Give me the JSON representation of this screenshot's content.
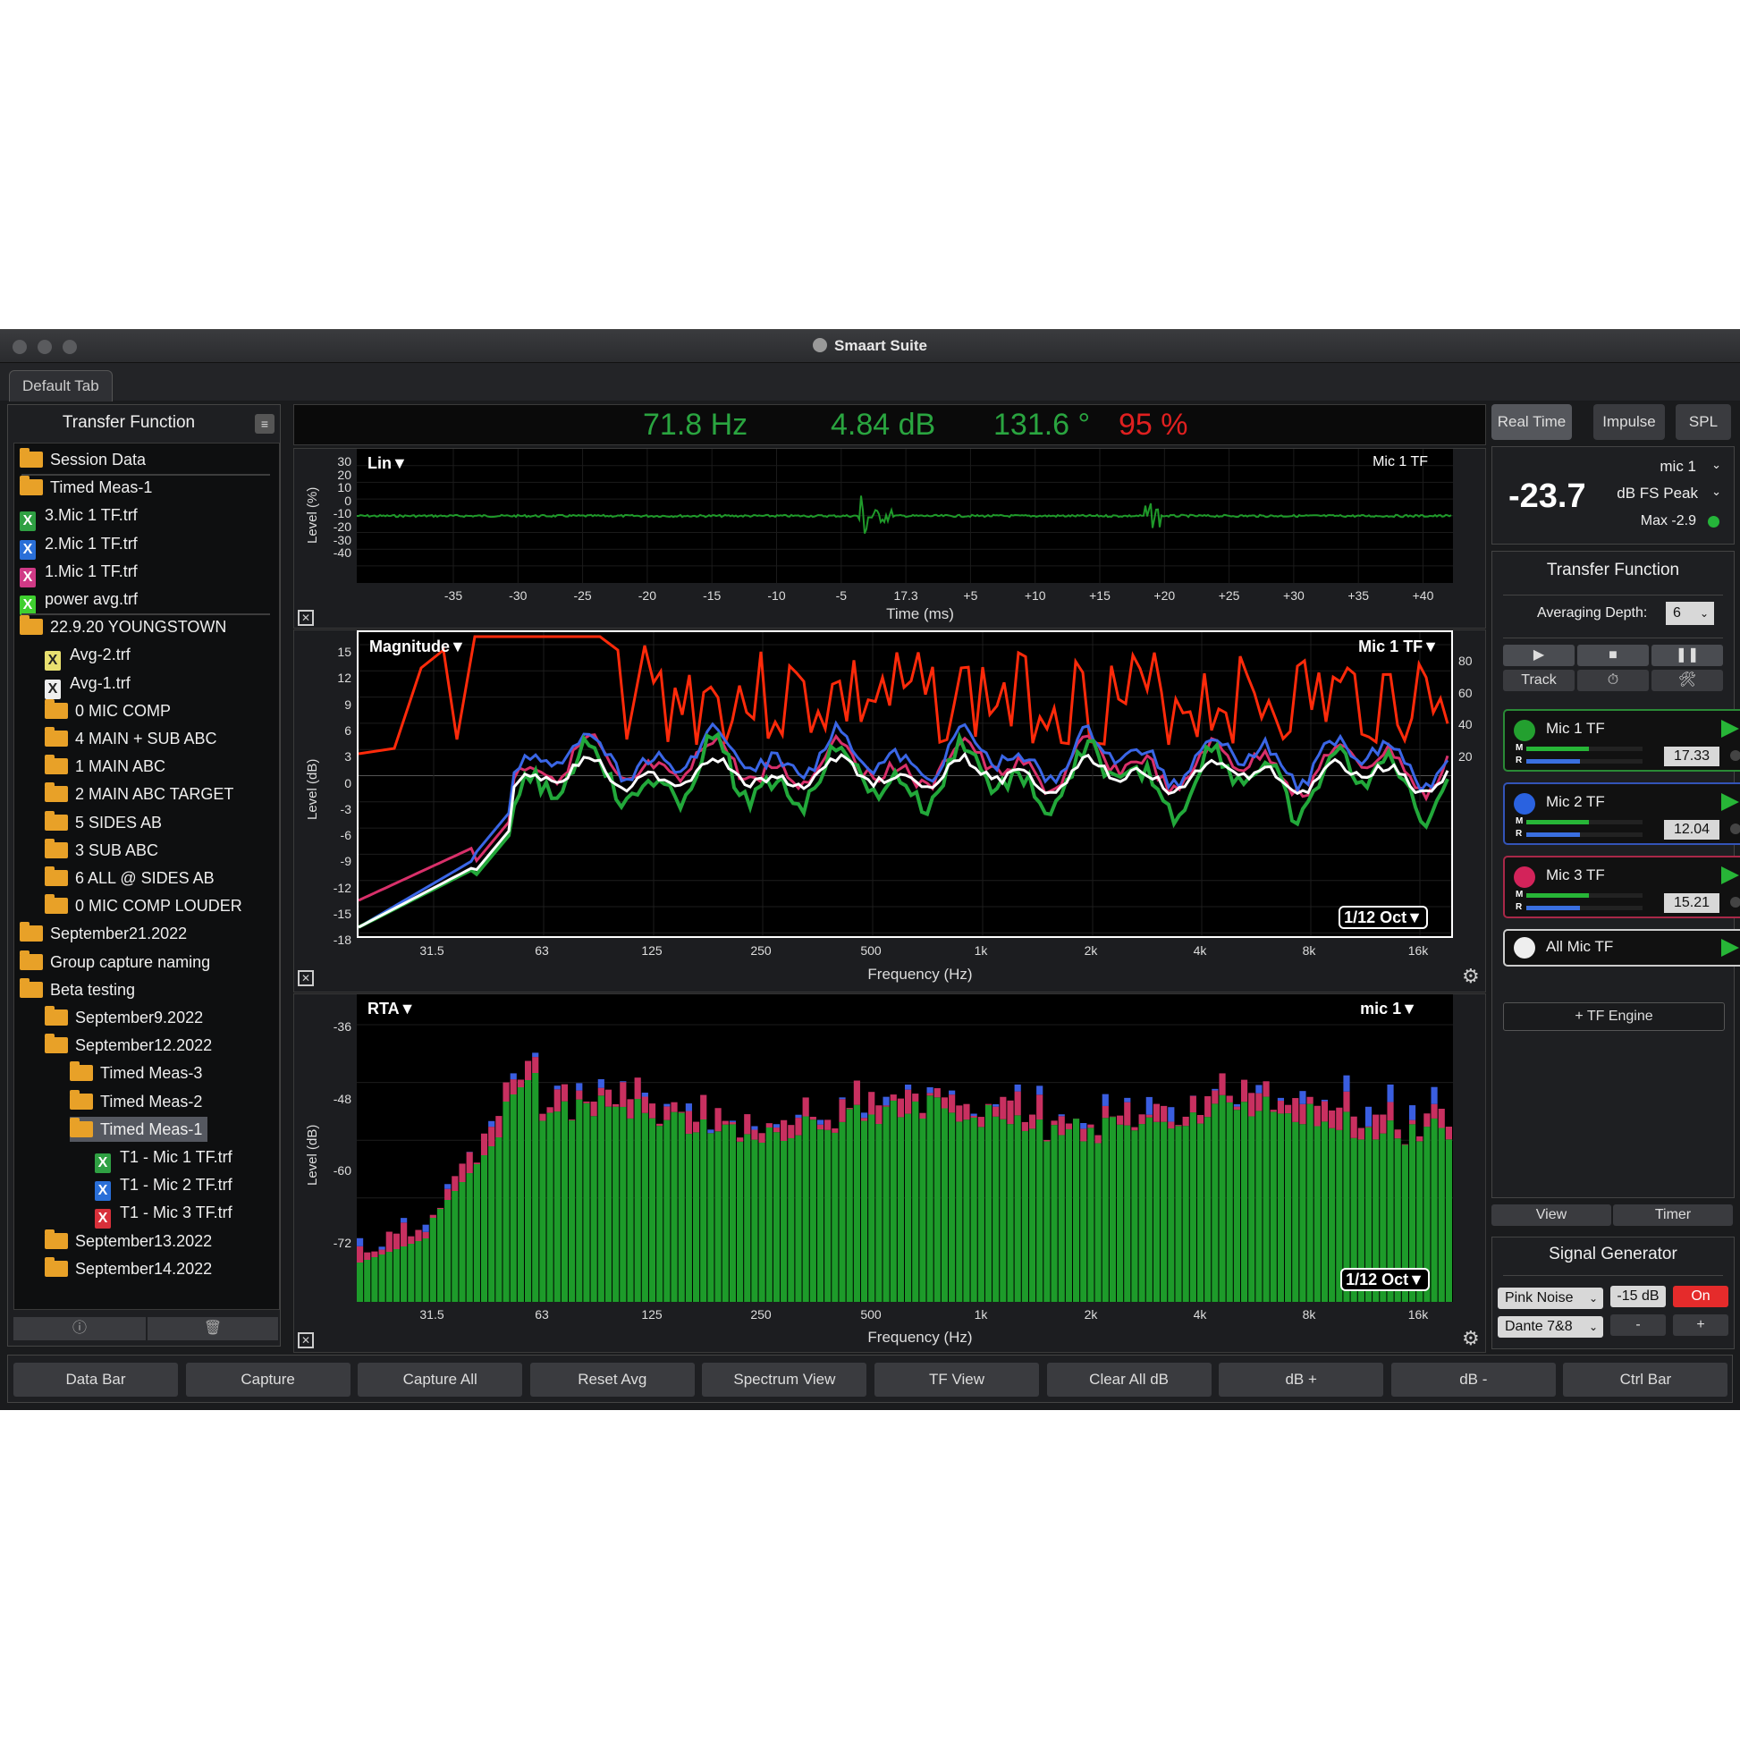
{
  "window": {
    "title": "Smaart Suite"
  },
  "tabs": [
    "Default Tab"
  ],
  "left": {
    "title": "Transfer Function",
    "tree": [
      {
        "label": "Session Data",
        "type": "folder",
        "indent": 0
      },
      {
        "label": "Timed Meas-1",
        "type": "folder",
        "indent": 0
      },
      {
        "label": "3.Mic 1 TF.trf",
        "type": "file",
        "color": "#2fa043",
        "indent": 0
      },
      {
        "label": "2.Mic 1 TF.trf",
        "type": "file",
        "color": "#2a6fd8",
        "indent": 0
      },
      {
        "label": "1.Mic 1 TF.trf",
        "type": "file",
        "color": "#d03a86",
        "indent": 0
      },
      {
        "label": "power avg.trf",
        "type": "file",
        "color": "#3fcf2f",
        "indent": 0
      },
      {
        "label": "22.9.20 YOUNGSTOWN",
        "type": "folder",
        "indent": 0
      },
      {
        "label": "Avg-2.trf",
        "type": "file",
        "color": "#e8e070",
        "indent": 1
      },
      {
        "label": "Avg-1.trf",
        "type": "file",
        "color": "#eeeeee",
        "indent": 1
      },
      {
        "label": "0 MIC COMP",
        "type": "folder",
        "indent": 1
      },
      {
        "label": "4 MAIN + SUB ABC",
        "type": "folder",
        "indent": 1
      },
      {
        "label": "1 MAIN ABC",
        "type": "folder",
        "indent": 1
      },
      {
        "label": "2 MAIN ABC TARGET",
        "type": "folder",
        "indent": 1
      },
      {
        "label": "5 SIDES AB",
        "type": "folder",
        "indent": 1
      },
      {
        "label": "3 SUB ABC",
        "type": "folder",
        "indent": 1
      },
      {
        "label": "6 ALL @ SIDES AB",
        "type": "folder",
        "indent": 1
      },
      {
        "label": "0 MIC COMP LOUDER",
        "type": "folder",
        "indent": 1
      },
      {
        "label": "September21.2022",
        "type": "folder",
        "indent": 0
      },
      {
        "label": "Group capture naming",
        "type": "folder",
        "indent": 0
      },
      {
        "label": "Beta testing",
        "type": "folder",
        "indent": 0
      },
      {
        "label": "September9.2022",
        "type": "folder",
        "indent": 1
      },
      {
        "label": "September12.2022",
        "type": "folder",
        "indent": 1
      },
      {
        "label": "Timed Meas-3",
        "type": "folder",
        "indent": 2
      },
      {
        "label": "Timed Meas-2",
        "type": "folder",
        "indent": 2
      },
      {
        "label": "Timed Meas-1",
        "type": "folder",
        "indent": 2,
        "selected": true
      },
      {
        "label": "T1 - Mic 1 TF.trf",
        "type": "file",
        "color": "#2fa043",
        "indent": 3
      },
      {
        "label": "T1 - Mic 2 TF.trf",
        "type": "file",
        "color": "#2a6fd8",
        "indent": 3
      },
      {
        "label": "T1 - Mic 3 TF.trf",
        "type": "file",
        "color": "#d8303a",
        "indent": 3
      },
      {
        "label": "September13.2022",
        "type": "folder",
        "indent": 1
      },
      {
        "label": "September14.2022",
        "type": "folder",
        "indent": 1
      }
    ],
    "footer": {
      "info_icon": "ⓘ",
      "trash_icon": "🗑"
    }
  },
  "readout": {
    "freq": "71.8 Hz",
    "mag": "4.84 dB",
    "phase": "131.6 °",
    "coh": "95 %",
    "colors": {
      "freq": "#2aa540",
      "mag": "#2aa540",
      "phase": "#2aa540",
      "coh": "#e02020"
    }
  },
  "impulse": {
    "scale": "Lin▼",
    "trace": "Mic 1 TF",
    "ylabel": "Level (%)",
    "xtitle": "Time (ms)",
    "yticks": [
      "30",
      "20",
      "10",
      "0",
      "-10",
      "-20",
      "-30",
      "-40"
    ],
    "xticks": [
      "-35",
      "-30",
      "-25",
      "-20",
      "-15",
      "-10",
      "-5",
      "17.3",
      "+5",
      "+10",
      "+15",
      "+20",
      "+25",
      "+30",
      "+35",
      "+40"
    ]
  },
  "tf": {
    "label": "Magnitude▼",
    "trace": "Mic 1 TF▼",
    "badge": "1/12 Oct▼",
    "ylabel": "Level (dB)",
    "xtitle": "Frequency (Hz)",
    "yticks": [
      "15",
      "12",
      "9",
      "6",
      "3",
      "0",
      "-3",
      "-6",
      "-9",
      "-12",
      "-15",
      "-18"
    ],
    "yticks_right": [
      "80",
      "60",
      "40",
      "20"
    ],
    "xticks": [
      "31.5",
      "63",
      "125",
      "250",
      "500",
      "1k",
      "2k",
      "4k",
      "8k",
      "16k"
    ]
  },
  "rta": {
    "label": "RTA▼",
    "trace": "mic 1▼",
    "badge": "1/12 Oct▼",
    "ylabel": "Level (dB)",
    "xtitle": "Frequency (Hz)",
    "yticks": [
      "-36",
      "-48",
      "-60",
      "-72"
    ],
    "xticks": [
      "31.5",
      "63",
      "125",
      "250",
      "500",
      "1k",
      "2k",
      "4k",
      "8k",
      "16k"
    ]
  },
  "right": {
    "modes": [
      "Real Time",
      "Impulse",
      "SPL"
    ],
    "meter": {
      "source": "mic 1",
      "value": "-23.7",
      "unit": "dB FS Peak",
      "max": "Max -2.9"
    },
    "tf_title": "Transfer Function",
    "avg_label": "Averaging Depth:",
    "avg_value": "6",
    "transport": {
      "play": "▶",
      "stop": "■",
      "pause": "❚❚",
      "track": "Track",
      "timer": "⏱",
      "tools": "🛠"
    },
    "engines": [
      {
        "name": "Mic 1 TF",
        "color": "#23a02f",
        "value": "17.33",
        "border": "#2a8a36"
      },
      {
        "name": "Mic 2 TF",
        "color": "#2a62e0",
        "value": "12.04",
        "border": "#3354b8"
      },
      {
        "name": "Mic 3 TF",
        "color": "#d3235a",
        "value": "15.21",
        "border": "#a82848"
      },
      {
        "name": "All Mic TF",
        "color": "#eeeeee",
        "value": "",
        "border": "#cccccc"
      }
    ],
    "add_engine": "+ TF Engine",
    "view_tabs": [
      "View",
      "Timer"
    ],
    "siggen": {
      "title": "Signal Generator",
      "type": "Pink Noise",
      "level": "-15 dB",
      "on": "On",
      "out": "Dante 7&8",
      "minus": "-",
      "plus": "+"
    }
  },
  "bottom": [
    "Data Bar",
    "Capture",
    "Capture All",
    "Reset Avg",
    "Spectrum View",
    "TF View",
    "Clear All dB",
    "dB +",
    "dB -",
    "Ctrl Bar"
  ]
}
